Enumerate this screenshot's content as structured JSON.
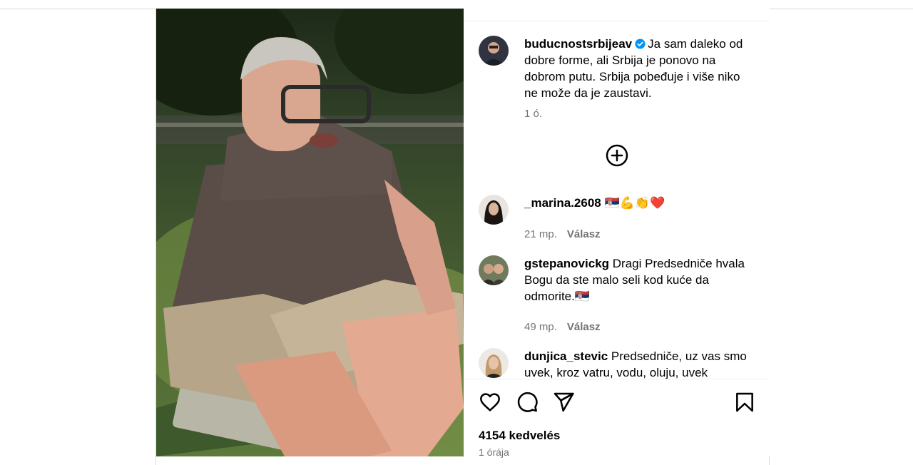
{
  "post": {
    "author": "buducnostsrbijeav",
    "verified": true,
    "caption": "Ja sam daleko od dobre forme, ali Srbija je ponovo na dobrom putu. Srbija pobeđuje i više niko ne može da je zaustavi.",
    "caption_age": "1 ó.",
    "likes": "4154 kedvelés",
    "time": "1 órája"
  },
  "comments": [
    {
      "user": "_marina.2608",
      "text": "🇷🇸💪👏❤️",
      "age": "21 mp.",
      "reply": "Válasz"
    },
    {
      "user": "gstepanovickg",
      "text": "Dragi Predsedniče hvala Bogu da ste malo seli kod kuće da odmorite.🇷🇸",
      "age": "49 mp.",
      "reply": "Válasz"
    },
    {
      "user": "dunjica_stevic",
      "text": "Predsedniče, uz vas smo uvek, kroz vatru, vodu, oluju, uvek"
    }
  ],
  "icons": {
    "load_more": "plus-circle-icon",
    "like": "heart-icon",
    "comment": "comment-icon",
    "share": "share-icon",
    "save": "bookmark-icon",
    "verified": "verified-badge-icon"
  },
  "colors": {
    "verified": "#0095f6",
    "secondary_text": "#737373",
    "border": "#dbdbdb"
  }
}
